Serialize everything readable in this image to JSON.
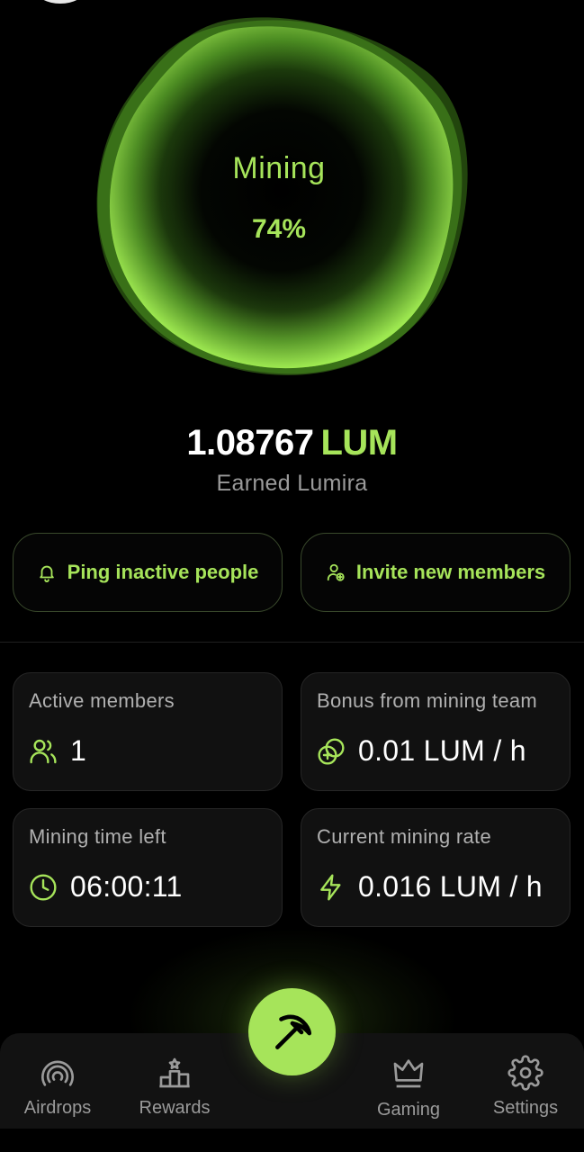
{
  "mining": {
    "label": "Mining",
    "percent_text": "74%",
    "progress": 0.74
  },
  "earned": {
    "amount": "1.08767",
    "currency": "LUM",
    "subtitle": "Earned Lumira"
  },
  "actions": {
    "ping_label": "Ping inactive people",
    "invite_label": "Invite new members"
  },
  "stats": [
    {
      "title": "Active members",
      "value": "1",
      "icon": "users-icon"
    },
    {
      "title": "Bonus from mining team",
      "value": "0.01 LUM / h",
      "icon": "coins-icon"
    },
    {
      "title": "Mining time left",
      "value": "06:00:11",
      "icon": "clock-icon"
    },
    {
      "title": "Current mining rate",
      "value": "0.016 LUM / h",
      "icon": "lightning-icon"
    }
  ],
  "nav": {
    "items": [
      {
        "label": "Airdrops",
        "icon": "airdrop-icon"
      },
      {
        "label": "Rewards",
        "icon": "podium-icon"
      },
      {
        "label": "Gaming",
        "icon": "crown-icon"
      },
      {
        "label": "Settings",
        "icon": "gear-icon"
      }
    ],
    "center_icon": "pickaxe-icon"
  },
  "colors": {
    "accent": "#a6e45a",
    "background": "#000000",
    "card": "#111111",
    "muted_text": "#9a9a9a"
  }
}
